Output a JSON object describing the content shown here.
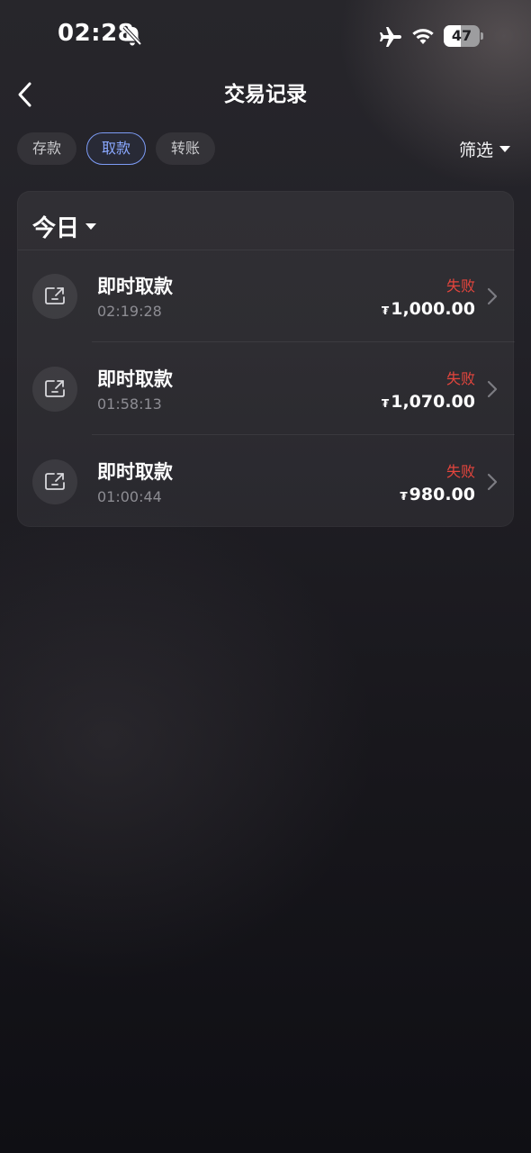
{
  "status_bar": {
    "time": "02:28",
    "battery": "47",
    "icons": [
      "bell-slash-icon",
      "airplane-icon",
      "wifi-icon",
      "battery-icon"
    ]
  },
  "nav": {
    "back_icon": "chevron-left-icon",
    "title": "交易记录"
  },
  "tabs": [
    {
      "label": "存款",
      "active": false
    },
    {
      "label": "取款",
      "active": true
    },
    {
      "label": "转账",
      "active": false
    }
  ],
  "filter": {
    "label": "筛选",
    "icon": "caret-down-icon"
  },
  "date_group": {
    "label": "今日",
    "icon": "caret-down-icon"
  },
  "transactions": [
    {
      "title": "即时取款",
      "time": "02:19:28",
      "status": "失败",
      "currency": "₮",
      "amount": "1,000.00",
      "icon": "withdraw-icon"
    },
    {
      "title": "即时取款",
      "time": "01:58:13",
      "status": "失败",
      "currency": "₮",
      "amount": "1,070.00",
      "icon": "withdraw-icon"
    },
    {
      "title": "即时取款",
      "time": "01:00:44",
      "status": "失败",
      "currency": "₮",
      "amount": "980.00",
      "icon": "withdraw-icon"
    }
  ],
  "colors": {
    "accent": "#7d9cf5",
    "failed": "#e5453d",
    "background": "#1b1a1f"
  }
}
